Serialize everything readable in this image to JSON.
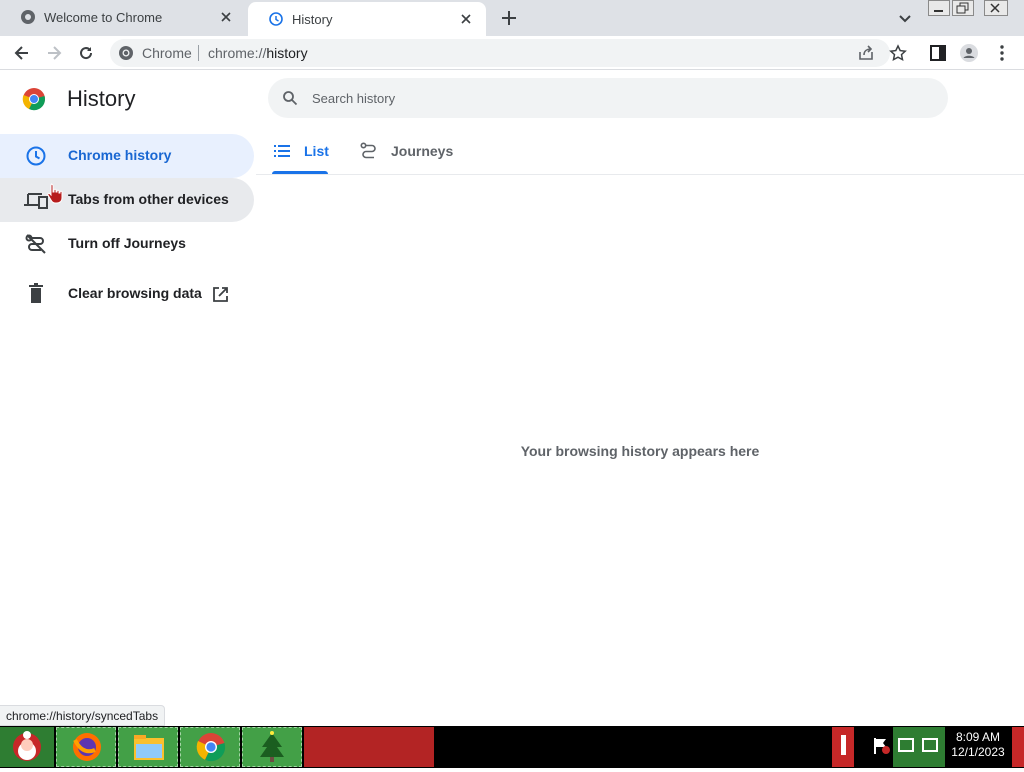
{
  "browser": {
    "tabs": [
      {
        "title": "Welcome to Chrome",
        "active": false
      },
      {
        "title": "History",
        "active": true
      }
    ],
    "omnibox": {
      "label": "Chrome",
      "url_prefix": "chrome://",
      "url_path": "history"
    }
  },
  "page": {
    "title": "History",
    "search": {
      "placeholder": "Search history",
      "value": ""
    },
    "sidebar": {
      "items": [
        {
          "label": "Chrome history",
          "icon": "clock-icon",
          "selected": true
        },
        {
          "label": "Tabs from other devices",
          "icon": "devices-icon",
          "selected": false
        },
        {
          "label": "Turn off Journeys",
          "icon": "journeys-off-icon",
          "selected": false
        },
        {
          "label": "Clear browsing data",
          "icon": "trash-icon",
          "selected": false
        }
      ]
    },
    "tabs": [
      {
        "label": "List",
        "icon": "list-icon",
        "selected": true
      },
      {
        "label": "Journeys",
        "icon": "journeys-icon",
        "selected": false
      }
    ],
    "empty_message": "Your browsing history appears here"
  },
  "status_bar": {
    "url": "chrome://history/syncedTabs"
  },
  "taskbar": {
    "time": "8:09 AM",
    "date": "12/1/2023"
  },
  "colors": {
    "accent": "#1a73e8",
    "selected_bg": "#e8f0fe",
    "tabstrip": "#dee1e6"
  }
}
